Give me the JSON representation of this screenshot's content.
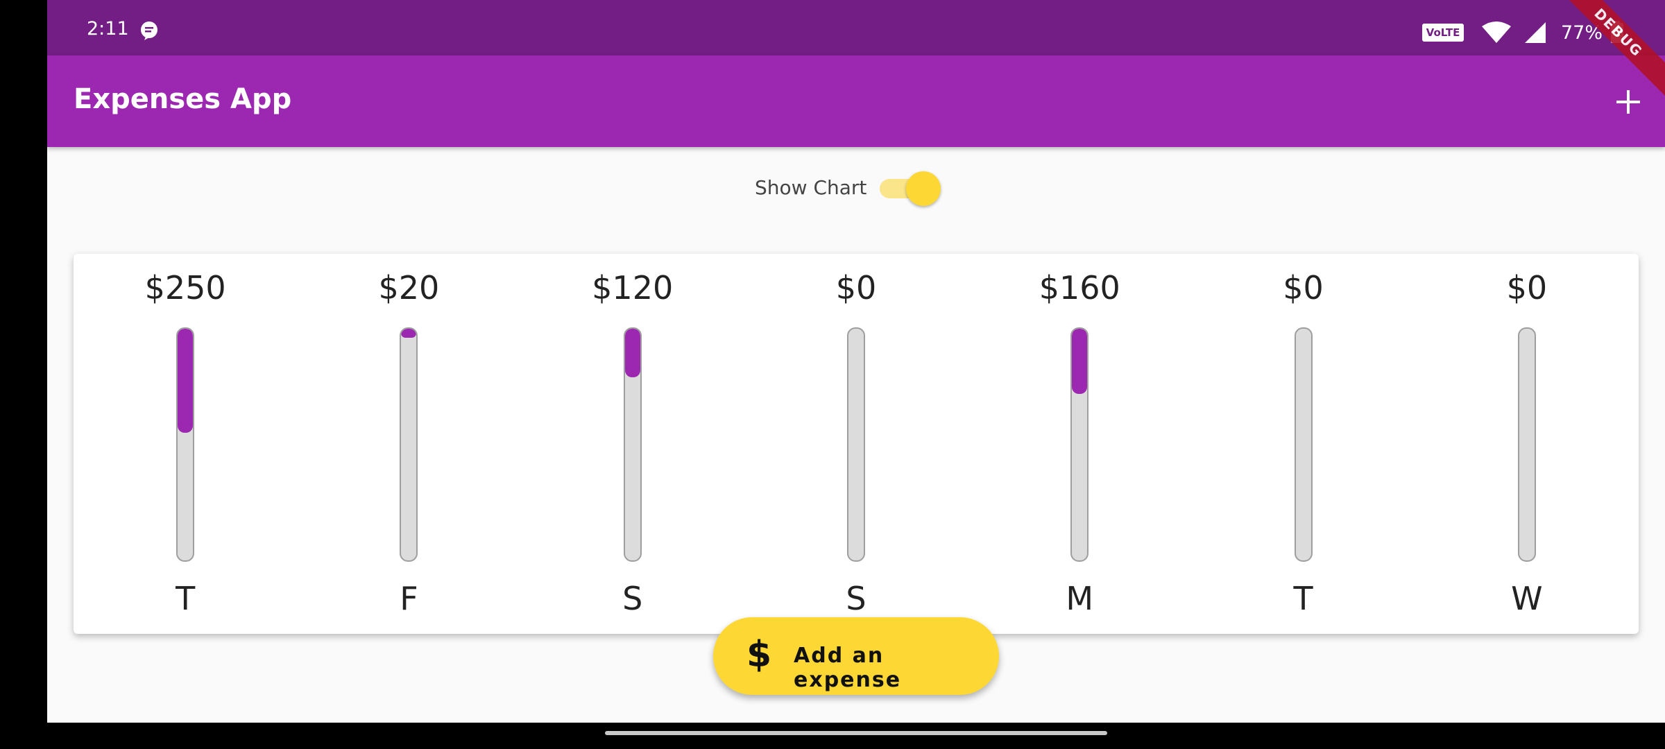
{
  "status_bar": {
    "time": "2:11",
    "volte": "VoLTE",
    "battery": "77%"
  },
  "debug_banner": "DEBUG",
  "app_bar": {
    "title": "Expenses App",
    "add_icon": "plus-icon"
  },
  "toggle": {
    "label": "Show Chart",
    "checked": true
  },
  "chart": {
    "bars": [
      {
        "day": "T",
        "amount": "$250",
        "fill_pct": 0.45
      },
      {
        "day": "F",
        "amount": "$20",
        "fill_pct": 0.04
      },
      {
        "day": "S",
        "amount": "$120",
        "fill_pct": 0.21
      },
      {
        "day": "S",
        "amount": "$0",
        "fill_pct": 0
      },
      {
        "day": "M",
        "amount": "$160",
        "fill_pct": 0.28
      },
      {
        "day": "T",
        "amount": "$0",
        "fill_pct": 0
      },
      {
        "day": "W",
        "amount": "$0",
        "fill_pct": 0
      }
    ]
  },
  "fab": {
    "icon": "dollar-icon",
    "icon_glyph": "$",
    "label": "Add an expense"
  },
  "colors": {
    "primary": "#9c27b0",
    "status_bar": "#731e84",
    "accent": "#fdd835"
  }
}
